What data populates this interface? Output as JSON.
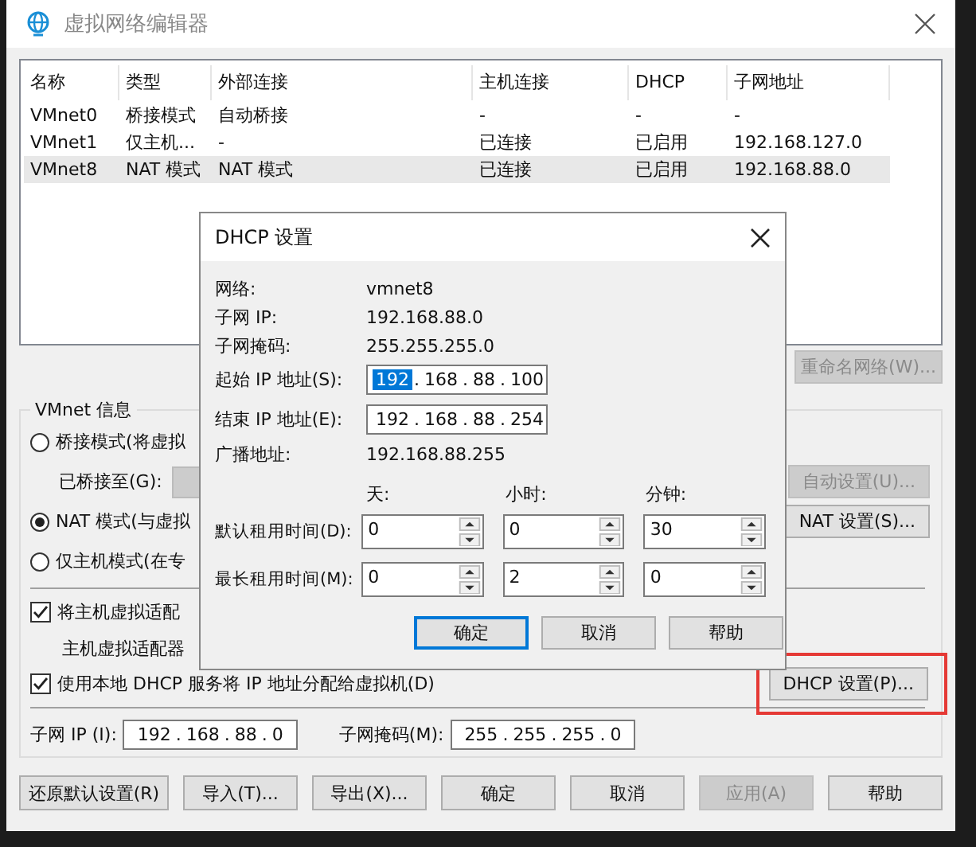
{
  "window": {
    "title": "虚拟网络编辑器"
  },
  "network_table": {
    "columns": [
      "名称",
      "类型",
      "外部连接",
      "主机连接",
      "DHCP",
      "子网地址"
    ],
    "rows": [
      {
        "cells": [
          "VMnet0",
          "桥接模式",
          "自动桥接",
          "-",
          "-",
          "-"
        ],
        "selected": false
      },
      {
        "cells": [
          "VMnet1",
          "仅主机...",
          "-",
          "已连接",
          "已启用",
          "192.168.127.0"
        ],
        "selected": false
      },
      {
        "cells": [
          "VMnet8",
          "NAT 模式",
          "NAT 模式",
          "已连接",
          "已启用",
          "192.168.88.0"
        ],
        "selected": true
      }
    ]
  },
  "rename_button": {
    "label": "重命名网络(W)...",
    "disabled": true
  },
  "vmnet_info": {
    "title": "VMnet 信息",
    "modes": [
      {
        "label": "桥接模式(将虚拟",
        "selected": false
      },
      {
        "label": "NAT 模式(与虚拟",
        "selected": true
      },
      {
        "label": "仅主机模式(在专",
        "selected": false
      }
    ],
    "bridged_to": {
      "label": "已桥接至(G):",
      "disabled": true
    },
    "auto_settings_button": {
      "label": "自动设置(U)...",
      "disabled": true
    },
    "nat_settings_button": {
      "label": "NAT 设置(S)...",
      "disabled": false
    },
    "host_adapter": {
      "label": "将主机虚拟适配",
      "checked": true
    },
    "host_adapter_name": "主机虚拟适配器",
    "dhcp": {
      "label": "使用本地 DHCP 服务将 IP 地址分配给虚拟机(D)",
      "checked": true
    },
    "dhcp_settings_button": {
      "label": "DHCP 设置(P)...",
      "highlighted": true
    },
    "subnet_ip": {
      "label": "子网 IP (I):",
      "separator": ".",
      "octets": [
        "192",
        "168",
        "88",
        "0"
      ]
    },
    "subnet_mask": {
      "label": "子网掩码(M):",
      "separator": ".",
      "octets": [
        "255",
        "255",
        "255",
        "0"
      ]
    }
  },
  "buttons": [
    {
      "label": "还原默认设置(R)",
      "disabled": false
    },
    {
      "label": "导入(T)...",
      "disabled": false
    },
    {
      "label": "导出(X)...",
      "disabled": false
    },
    {
      "label": "确定",
      "disabled": false
    },
    {
      "label": "取消",
      "disabled": false
    },
    {
      "label": "应用(A)",
      "disabled": true
    },
    {
      "label": "帮助",
      "disabled": false
    }
  ],
  "dhcp_dialog": {
    "title": "DHCP 设置",
    "info": [
      {
        "label": "网络:",
        "value": "vmnet8"
      },
      {
        "label": "子网 IP:",
        "value": "192.168.88.0"
      },
      {
        "label": "子网掩码:",
        "value": "255.255.255.0"
      }
    ],
    "start_ip": {
      "label": "起始 IP 地址(S):",
      "separator": ".",
      "octets": [
        {
          "text": "192",
          "selected": true
        },
        {
          "text": "168",
          "selected": false
        },
        {
          "text": "88",
          "selected": false
        },
        {
          "text": "100",
          "selected": false
        }
      ]
    },
    "end_ip": {
      "label": "结束 IP 地址(E):",
      "separator": ".",
      "octets": [
        {
          "text": "192",
          "selected": false
        },
        {
          "text": "168",
          "selected": false
        },
        {
          "text": "88",
          "selected": false
        },
        {
          "text": "254",
          "selected": false
        }
      ]
    },
    "broadcast": {
      "label": "广播地址:",
      "value": "192.168.88.255"
    },
    "lease_headers": [
      "天:",
      "小时:",
      "分钟:"
    ],
    "leases": [
      {
        "label": "默认租用时间(D):",
        "values": [
          "0",
          "0",
          "30"
        ]
      },
      {
        "label": "最长租用时间(M):",
        "values": [
          "0",
          "2",
          "0"
        ]
      }
    ],
    "buttons": [
      {
        "label": "确定",
        "default": true
      },
      {
        "label": "取消",
        "default": false
      },
      {
        "label": "帮助",
        "default": false
      }
    ]
  }
}
